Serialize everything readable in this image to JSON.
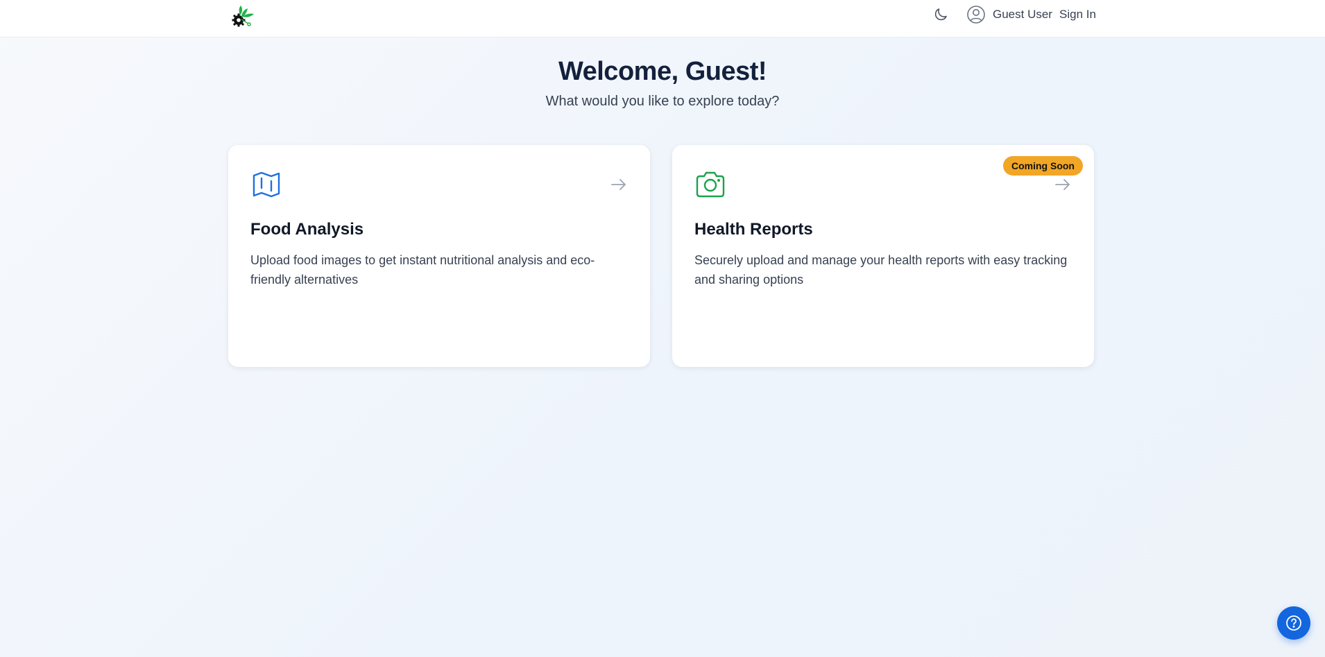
{
  "header": {
    "user_name": "Guest User",
    "sign_in_label": "Sign In"
  },
  "hero": {
    "title": "Welcome, Guest!",
    "subtitle": "What would you like to explore today?"
  },
  "cards": [
    {
      "title": "Food Analysis",
      "description": "Upload food images to get instant nutritional analysis and eco-friendly alternatives",
      "icon": "map-icon",
      "icon_color": "#1f6fe0"
    },
    {
      "title": "Health Reports",
      "description": "Securely upload and manage your health reports with easy tracking and sharing options",
      "icon": "camera-icon",
      "icon_color": "#1aa34a",
      "badge": "Coming Soon"
    }
  ],
  "colors": {
    "badge_bg": "#f2a626",
    "help_button_bg": "#1366dd",
    "title_color": "#14213d"
  }
}
